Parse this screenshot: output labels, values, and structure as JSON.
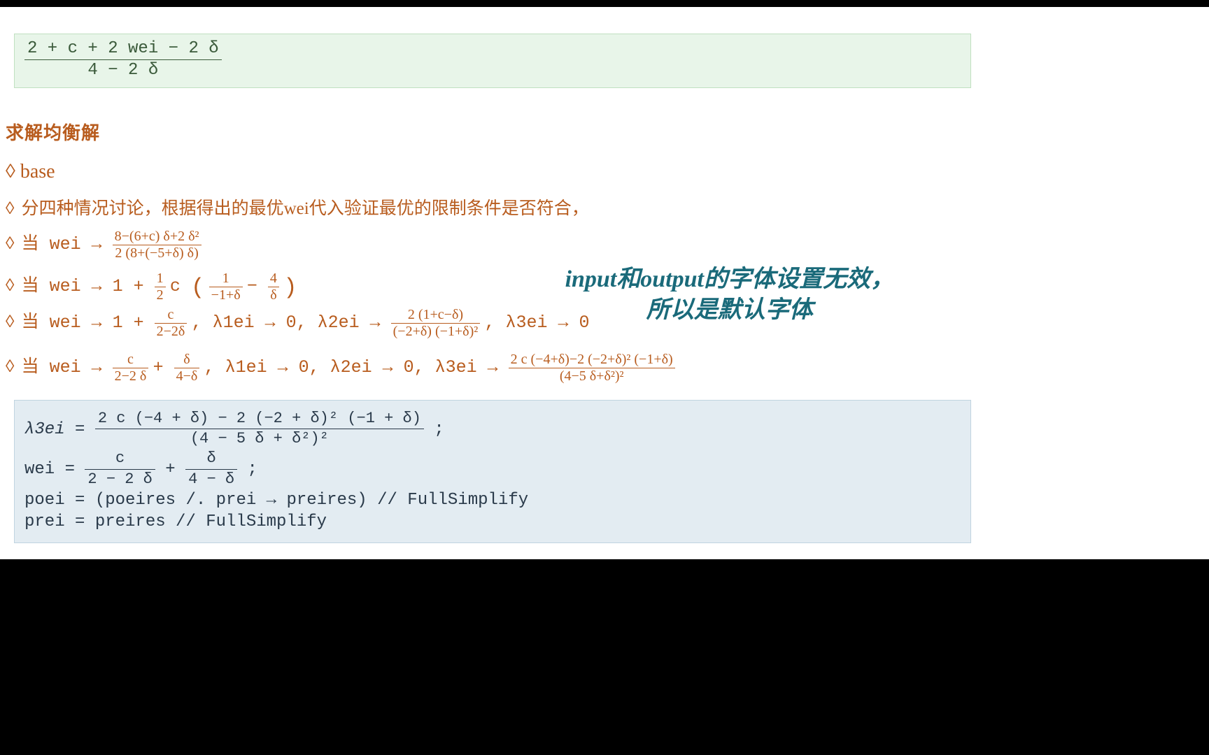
{
  "output_cell": {
    "numerator": "2 + c + 2 wei − 2 δ",
    "denominator": "4 − 2 δ"
  },
  "section_title": "求解均衡解",
  "subsection_base": "◊ base",
  "bullet_intro": "分四种情况讨论，根据得出的最优wei代入验证最优的限制条件是否符合，",
  "case1": {
    "prefix": "当  wei → ",
    "num": "8−(6+c) δ+2 δ²",
    "den": "2 (8+(−5+δ) δ)"
  },
  "case2": {
    "prefix": "当  wei → 1 + ",
    "half_num": "1",
    "half_den": "2",
    "c_label": " c ",
    "inner1_num": "1",
    "inner1_den": "−1+δ",
    "minus": " − ",
    "inner2_num": "4",
    "inner2_den": "δ"
  },
  "case3": {
    "prefix": "当  wei → 1 + ",
    "f1_num": "c",
    "f1_den": "2−2δ",
    "after_f1": ", λ1ei → 0, λ2ei → ",
    "f2_num": "2 (1+c−δ)",
    "f2_den": "(−2+δ) (−1+δ)²",
    "after_f2": ", λ3ei → 0"
  },
  "case4": {
    "prefix": "当  wei → ",
    "fa_num": "c",
    "fa_den": "2−2 δ",
    "plus": " + ",
    "fb_num": "δ",
    "fb_den": "4−δ",
    "mid": ", λ1ei → 0, λ2ei → 0, λ3ei → ",
    "fc_num": "2 c (−4+δ)−2 (−2+δ)² (−1+δ)",
    "fc_den": "(4−5 δ+δ²)²"
  },
  "annotation": {
    "line1": "input和output的字体设置无效，",
    "line2": "所以是默认字体"
  },
  "input_cell": {
    "l1_lhs": "λ3ei = ",
    "l1_num": "2 c (−4 + δ) − 2 (−2 + δ)² (−1 + δ)",
    "l1_den": "(4 − 5 δ + δ²)²",
    "l1_end": ";",
    "l2_lhs": "wei = ",
    "l2a_num": "c",
    "l2a_den": "2 − 2 δ",
    "l2_plus": " + ",
    "l2b_num": "δ",
    "l2b_den": "4 − δ",
    "l2_end": ";",
    "l3": "poei = (poeires /. prei → preires) // FullSimplify",
    "l4": "prei = preires // FullSimplify"
  }
}
